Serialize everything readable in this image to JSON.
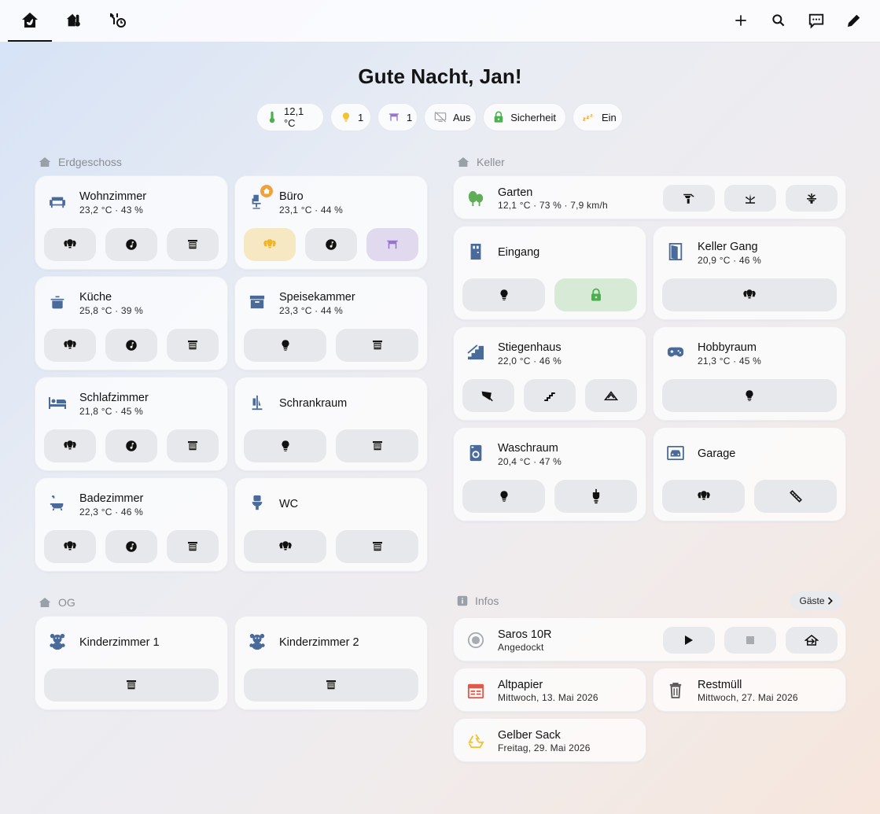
{
  "topbar": {
    "tabs": [
      {
        "icon": "home-leaf-icon"
      },
      {
        "icon": "home-thermometer-icon"
      },
      {
        "icon": "tools-clock-icon"
      }
    ],
    "actions": [
      {
        "icon": "plus-icon"
      },
      {
        "icon": "search-icon"
      },
      {
        "icon": "chat-icon"
      },
      {
        "icon": "pencil-icon"
      }
    ]
  },
  "greeting": "Gute Nacht, Jan!",
  "chips": [
    {
      "icon": "thermometer-icon",
      "label": "12,1 °C",
      "color": "#4caf50"
    },
    {
      "icon": "bulb-icon",
      "label": "1",
      "color": "#f4c430"
    },
    {
      "icon": "gate-icon",
      "label": "1",
      "color": "#9575cd"
    },
    {
      "icon": "tv-off-icon",
      "label": "Aus",
      "color": "#9e9e9e"
    },
    {
      "icon": "lock-icon",
      "label": "Sicherheit",
      "color": "#4caf50"
    },
    {
      "icon": "sleep-icon",
      "label": "Ein",
      "color": "#ff9800"
    }
  ],
  "sections": {
    "erdgeschoss": "Erdgeschoss",
    "keller": "Keller",
    "og": "OG",
    "infos": "Infos"
  },
  "rooms": {
    "wohnzimmer": {
      "name": "Wohnzimmer",
      "sub": "23,2 °C · 43 %"
    },
    "buero": {
      "name": "Büro",
      "sub": "23,1 °C · 44 %"
    },
    "kueche": {
      "name": "Küche",
      "sub": "25,8 °C · 39 %"
    },
    "speisekammer": {
      "name": "Speisekammer",
      "sub": "23,3 °C · 44 %"
    },
    "schlafzimmer": {
      "name": "Schlafzimmer",
      "sub": "21,8 °C · 45 %"
    },
    "schrankraum": {
      "name": "Schrankraum"
    },
    "badezimmer": {
      "name": "Badezimmer",
      "sub": "22,3 °C · 46 %"
    },
    "wc": {
      "name": "WC"
    },
    "garten": {
      "name": "Garten",
      "sub": "12,1 °C · 73 % · 7,9 km/h"
    },
    "eingang": {
      "name": "Eingang"
    },
    "keller_gang": {
      "name": "Keller Gang",
      "sub": "20,9 °C · 46 %"
    },
    "stiegenhaus": {
      "name": "Stiegenhaus",
      "sub": "22,0 °C · 46 %"
    },
    "hobbyraum": {
      "name": "Hobbyraum",
      "sub": "21,3 °C · 45 %"
    },
    "waschraum": {
      "name": "Waschraum",
      "sub": "20,4 °C · 47 %"
    },
    "garage": {
      "name": "Garage"
    },
    "kinderzimmer1": {
      "name": "Kinderzimmer 1"
    },
    "kinderzimmer2": {
      "name": "Kinderzimmer 2"
    }
  },
  "infos": {
    "gaeste_label": "Gäste",
    "vacuum": {
      "name": "Saros 10R",
      "sub": "Angedockt"
    },
    "altpapier": {
      "name": "Altpapier",
      "sub": "Mittwoch, 13. Mai 2026"
    },
    "restmuell": {
      "name": "Restmüll",
      "sub": "Mittwoch, 27. Mai 2026"
    },
    "gelber_sack": {
      "name": "Gelber Sack",
      "sub": "Freitag, 29. Mai 2026"
    }
  },
  "colors": {
    "room_icon": "#4a6a9a",
    "plant": "#5fad56",
    "active_light_bg": "#f6e8c3",
    "active_light_fg": "#f0b429",
    "active_gate_bg": "#e1d9ee",
    "active_gate_fg": "#9575cd",
    "lock_bg": "#d6ead6",
    "lock_fg": "#4caf50",
    "calendar_red": "#e05a4a",
    "recycle_yellow": "#f2c230"
  }
}
